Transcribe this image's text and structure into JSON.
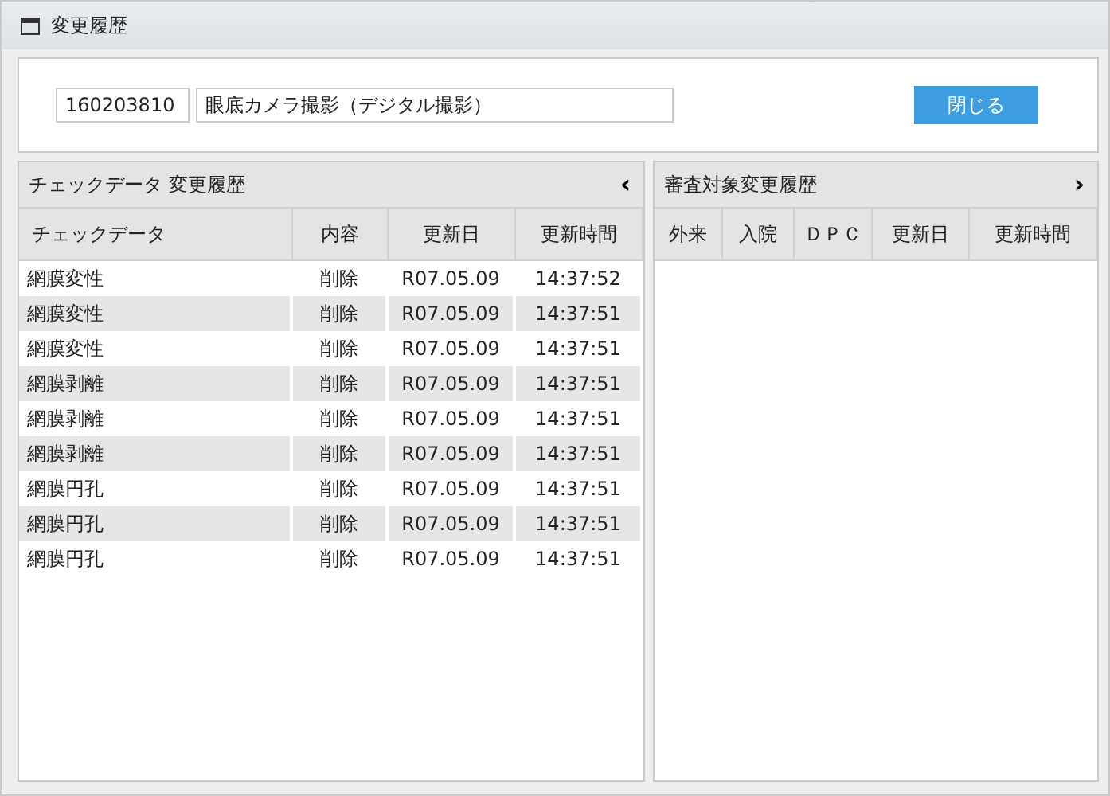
{
  "window": {
    "title": "変更履歴"
  },
  "header": {
    "code": "160203810",
    "name": "眼底カメラ撮影（デジタル撮影）",
    "close_button": "閉じる"
  },
  "left_panel": {
    "title": "チェックデータ 変更履歴",
    "toggle": "‹",
    "columns": [
      "チェックデータ",
      "内容",
      "更新日",
      "更新時間"
    ],
    "rows": [
      [
        "網膜変性",
        "削除",
        "R07.05.09",
        "14:37:52"
      ],
      [
        "網膜変性",
        "削除",
        "R07.05.09",
        "14:37:51"
      ],
      [
        "網膜変性",
        "削除",
        "R07.05.09",
        "14:37:51"
      ],
      [
        "網膜剥離",
        "削除",
        "R07.05.09",
        "14:37:51"
      ],
      [
        "網膜剥離",
        "削除",
        "R07.05.09",
        "14:37:51"
      ],
      [
        "網膜剥離",
        "削除",
        "R07.05.09",
        "14:37:51"
      ],
      [
        "網膜円孔",
        "削除",
        "R07.05.09",
        "14:37:51"
      ],
      [
        "網膜円孔",
        "削除",
        "R07.05.09",
        "14:37:51"
      ],
      [
        "網膜円孔",
        "削除",
        "R07.05.09",
        "14:37:51"
      ]
    ]
  },
  "right_panel": {
    "title": "審査対象変更履歴",
    "toggle": "›",
    "columns": [
      "外来",
      "入院",
      "ＤＰＣ",
      "更新日",
      "更新時間"
    ]
  }
}
